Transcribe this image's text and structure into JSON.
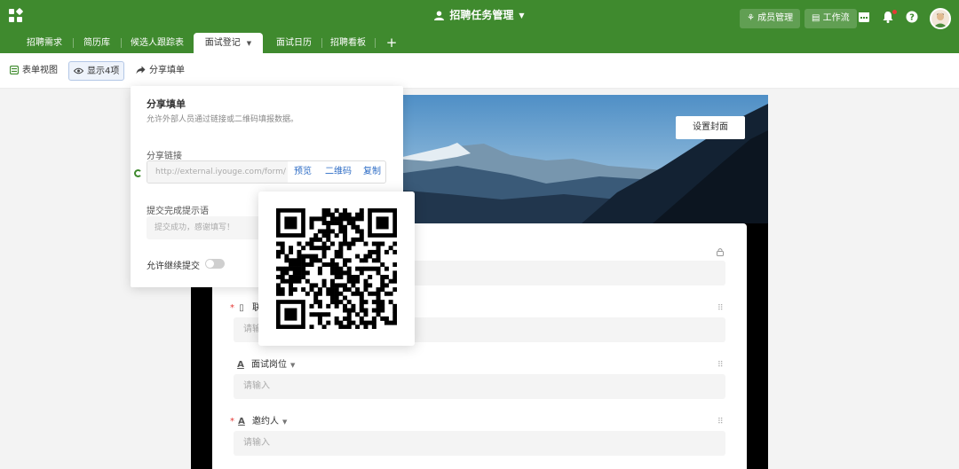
{
  "header": {
    "title": "招聘任务管理",
    "member_button": "成员管理",
    "workflow_button": "工作流"
  },
  "tabs": [
    {
      "label": "招聘需求"
    },
    {
      "label": "简历库"
    },
    {
      "label": "候选人跟踪表"
    },
    {
      "label": "面试登记",
      "active": true
    },
    {
      "label": "面试日历"
    },
    {
      "label": "招聘看板"
    }
  ],
  "toolbar": {
    "form_view": "表单视图",
    "show_fields": "显示4项",
    "share_form": "分享填单"
  },
  "cover": {
    "set_cover": "设置封面"
  },
  "form": {
    "fields": [
      {
        "label": "",
        "placeholder": ""
      },
      {
        "label": "联",
        "placeholder": "请输",
        "required": true
      },
      {
        "label": "面试岗位",
        "placeholder": "请输入"
      },
      {
        "label": "邀约人",
        "placeholder": "请输入",
        "required": true
      }
    ]
  },
  "share_panel": {
    "title": "分享填单",
    "desc": "允许外部人员通过链接或二维码填报数据。",
    "link_label": "分享链接",
    "link_value": "http://external.iyouge.com/form/",
    "preview": "预览",
    "qrcode": "二维码",
    "copy": "复制",
    "message_label": "提交完成提示语",
    "message_value": "提交成功，感谢填写！",
    "allow_continue": "允许继续提交"
  },
  "colors": {
    "brand_green": "#3f8a2e",
    "link_blue": "#2d6cc5"
  }
}
